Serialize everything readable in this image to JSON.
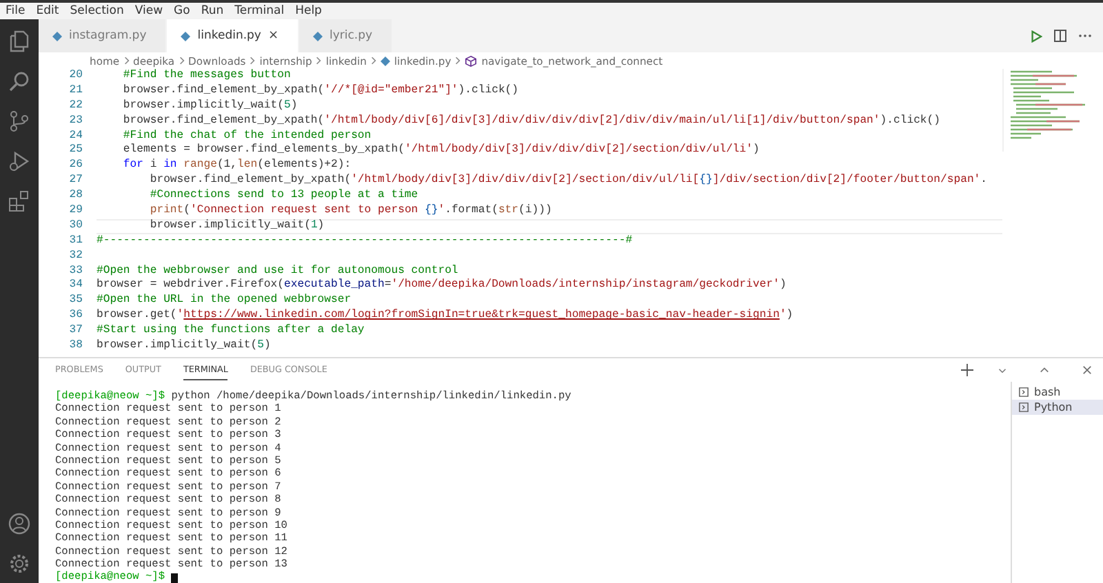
{
  "menu": [
    "File",
    "Edit",
    "Selection",
    "View",
    "Go",
    "Run",
    "Terminal",
    "Help"
  ],
  "tabs": [
    {
      "label": "instagram.py",
      "selected": false
    },
    {
      "label": "linkedin.py",
      "selected": true,
      "close": "×"
    },
    {
      "label": "lyric.py",
      "selected": false
    }
  ],
  "breadcrumbs": [
    {
      "label": "home",
      "kind": "folder"
    },
    {
      "label": "deepika",
      "kind": "folder"
    },
    {
      "label": "Downloads",
      "kind": "folder"
    },
    {
      "label": "internship",
      "kind": "folder"
    },
    {
      "label": "linkedin",
      "kind": "folder"
    },
    {
      "label": "linkedin.py",
      "kind": "file"
    },
    {
      "label": "navigate_to_network_and_connect",
      "kind": "symbol"
    }
  ],
  "code": [
    {
      "number": "20",
      "current": false,
      "tokens": [
        {
          "kind": "comment",
          "text": "    #Find the messages button"
        }
      ]
    },
    {
      "number": "21",
      "current": false,
      "tokens": [
        {
          "kind": "plain",
          "text": "    browser.find_element_by_xpath("
        },
        {
          "kind": "string",
          "text": "'//*[@id=\"ember21\"]'"
        },
        {
          "kind": "plain",
          "text": ").click()"
        }
      ]
    },
    {
      "number": "22",
      "current": false,
      "tokens": [
        {
          "kind": "plain",
          "text": "    browser.implicitly_wait("
        },
        {
          "kind": "number",
          "text": "5"
        },
        {
          "kind": "plain",
          "text": ")"
        }
      ]
    },
    {
      "number": "23",
      "current": false,
      "tokens": [
        {
          "kind": "plain",
          "text": "    browser.find_element_by_xpath("
        },
        {
          "kind": "string",
          "text": "'/html/body/div[6]/div[3]/div/div/div/div[2]/div/div/main/ul/li[1]/div/button/span'"
        },
        {
          "kind": "plain",
          "text": ").click()"
        }
      ]
    },
    {
      "number": "24",
      "current": false,
      "tokens": [
        {
          "kind": "comment",
          "text": "    #Find the chat of the intended person"
        }
      ]
    },
    {
      "number": "25",
      "current": false,
      "tokens": [
        {
          "kind": "plain",
          "text": "    elements = browser.find_elements_by_xpath("
        },
        {
          "kind": "string",
          "text": "'/html/body/div[3]/div/div/div[2]/section/div/ul/li'"
        },
        {
          "kind": "plain",
          "text": ")"
        }
      ]
    },
    {
      "number": "26",
      "current": false,
      "tokens": [
        {
          "kind": "keyword",
          "text": "    for"
        },
        {
          "kind": "plain",
          "text": " i "
        },
        {
          "kind": "keyword",
          "text": "in"
        },
        {
          "kind": "builtin",
          "text": " range"
        },
        {
          "kind": "plain",
          "text": "(1,"
        },
        {
          "kind": "builtin",
          "text": "len"
        },
        {
          "kind": "plain",
          "text": "(elements)+2):"
        }
      ]
    },
    {
      "number": "27",
      "current": false,
      "tokens": [
        {
          "kind": "plain",
          "text": "        browser.find_element_by_xpath("
        },
        {
          "kind": "string",
          "text": "'/html/body/div[3]/div/div/div[2]/section/div/ul/li["
        },
        {
          "kind": "bracket",
          "text": "{}"
        },
        {
          "kind": "string",
          "text": "]/div/section/div[2]/footer/button/span'"
        },
        {
          "kind": "plain",
          "text": "."
        }
      ]
    },
    {
      "number": "28",
      "current": false,
      "tokens": [
        {
          "kind": "comment",
          "text": "        #Connections send to 13 people at a time"
        }
      ]
    },
    {
      "number": "29",
      "current": false,
      "tokens": [
        {
          "kind": "builtin",
          "text": "        print"
        },
        {
          "kind": "plain",
          "text": "("
        },
        {
          "kind": "string",
          "text": "'Connection request sent to person "
        },
        {
          "kind": "bracket",
          "text": "{}"
        },
        {
          "kind": "string",
          "text": "'"
        },
        {
          "kind": "plain",
          "text": ".format("
        },
        {
          "kind": "builtin",
          "text": "str"
        },
        {
          "kind": "plain",
          "text": "(i)))"
        }
      ]
    },
    {
      "number": "30",
      "current": true,
      "tokens": [
        {
          "kind": "plain",
          "text": "        browser.implicitly_wait("
        },
        {
          "kind": "number",
          "text": "1"
        },
        {
          "kind": "plain",
          "text": ")"
        }
      ]
    },
    {
      "number": "31",
      "current": false,
      "tokens": [
        {
          "kind": "comment",
          "text": "#------------------------------------------------------------------------------#"
        }
      ]
    },
    {
      "number": "32",
      "current": false
    },
    {
      "number": "33",
      "current": false,
      "tokens": [
        {
          "kind": "comment",
          "text": "#Open the webbrowser and use it for autonomous control"
        }
      ]
    },
    {
      "number": "34",
      "current": false,
      "tokens": [
        {
          "kind": "plain",
          "text": "browser = webdriver.Firefox("
        },
        {
          "kind": "param",
          "text": "executable_path"
        },
        {
          "kind": "plain",
          "text": "="
        },
        {
          "kind": "string",
          "text": "'/home/deepika/Downloads/internship/instagram/geckodriver'"
        },
        {
          "kind": "plain",
          "text": ")"
        }
      ]
    },
    {
      "number": "35",
      "current": false,
      "tokens": [
        {
          "kind": "comment",
          "text": "#Open the URL in the opened webbrowser"
        }
      ]
    },
    {
      "number": "36",
      "current": false,
      "tokens": [
        {
          "kind": "plain",
          "text": "browser.get("
        },
        {
          "kind": "string",
          "text": "'"
        },
        {
          "kind": "link",
          "text": "https://www.linkedin.com/login?fromSignIn=true&trk=guest_homepage-basic_nav-header-signin"
        },
        {
          "kind": "string",
          "text": "'"
        },
        {
          "kind": "plain",
          "text": ")"
        }
      ]
    },
    {
      "number": "37",
      "current": false,
      "tokens": [
        {
          "kind": "comment",
          "text": "#Start using the functions after a delay"
        }
      ]
    },
    {
      "number": "38",
      "current": false,
      "tokens": [
        {
          "kind": "plain",
          "text": "browser.implicitly_wait("
        },
        {
          "kind": "number",
          "text": "5"
        },
        {
          "kind": "plain",
          "text": ")"
        }
      ]
    }
  ],
  "panel_tabs": [
    {
      "label": "PROBLEMS",
      "selected": false
    },
    {
      "label": "OUTPUT",
      "selected": false
    },
    {
      "label": "TERMINAL",
      "selected": true
    },
    {
      "label": "DEBUG CONSOLE",
      "selected": false
    }
  ],
  "terminal": [
    {
      "kind": "command",
      "prompt": "[deepika@neow ~]$",
      "text": "python /home/deepika/Downloads/internship/linkedin/linkedin.py"
    },
    {
      "kind": "output",
      "text": "Connection request sent to person 1"
    },
    {
      "kind": "output",
      "text": "Connection request sent to person 2"
    },
    {
      "kind": "output",
      "text": "Connection request sent to person 3"
    },
    {
      "kind": "output",
      "text": "Connection request sent to person 4"
    },
    {
      "kind": "output",
      "text": "Connection request sent to person 5"
    },
    {
      "kind": "output",
      "text": "Connection request sent to person 6"
    },
    {
      "kind": "output",
      "text": "Connection request sent to person 7"
    },
    {
      "kind": "output",
      "text": "Connection request sent to person 8"
    },
    {
      "kind": "output",
      "text": "Connection request sent to person 9"
    },
    {
      "kind": "output",
      "text": "Connection request sent to person 10"
    },
    {
      "kind": "output",
      "text": "Connection request sent to person 11"
    },
    {
      "kind": "output",
      "text": "Connection request sent to person 12"
    },
    {
      "kind": "output",
      "text": "Connection request sent to person 13"
    },
    {
      "kind": "prompt",
      "prompt": "[deepika@neow ~]$"
    }
  ],
  "terminals": [
    {
      "label": "bash",
      "selected": false
    },
    {
      "label": "Python",
      "selected": true
    }
  ]
}
